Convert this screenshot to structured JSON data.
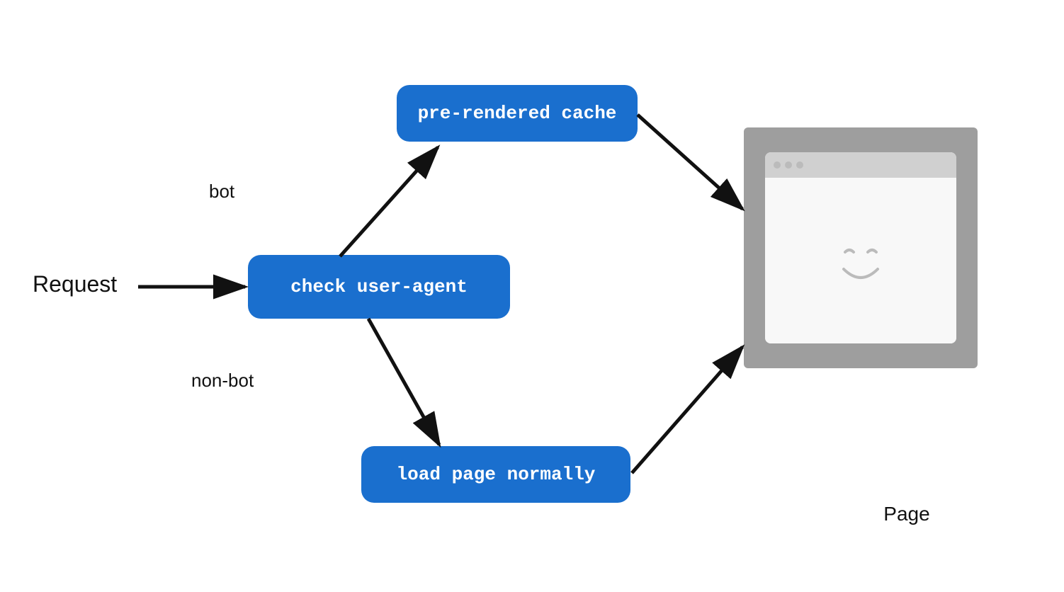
{
  "diagram": {
    "request_label": "Request",
    "bot_label": "bot",
    "nonbot_label": "non-bot",
    "page_label": "Page",
    "boxes": {
      "prerendered": "pre-rendered cache",
      "check_user_agent": "check user-agent",
      "load_page_normally": "load page normally"
    }
  },
  "colors": {
    "blue": "#1a6fce",
    "white": "#ffffff",
    "dark": "#111111",
    "gray_outer": "#9e9e9e",
    "gray_inner": "#f0f0f0",
    "gray_bar": "#d0d0d0"
  }
}
